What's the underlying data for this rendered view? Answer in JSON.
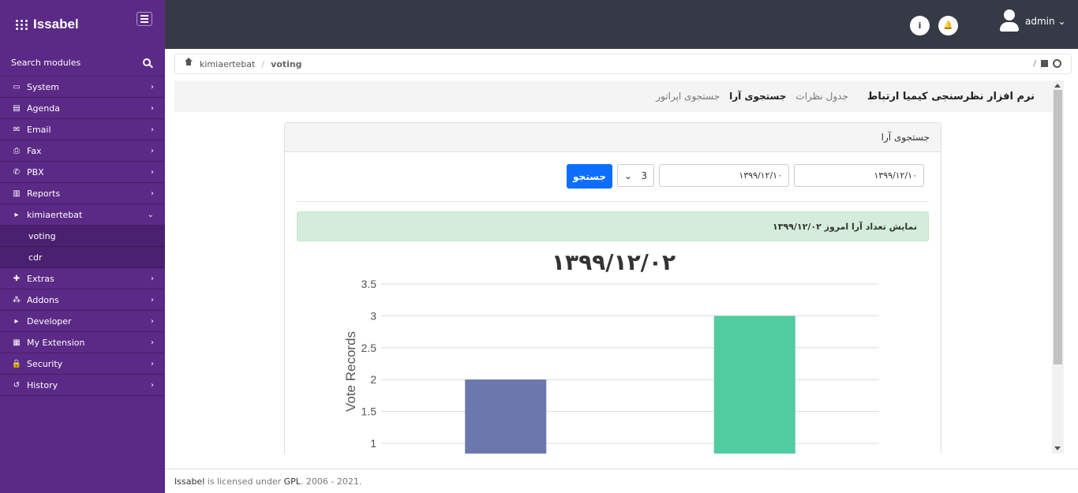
{
  "brand": {
    "name": "Issabel"
  },
  "sidebar": {
    "search_label": "Search modules",
    "items": [
      {
        "label": "System",
        "icon": "laptop-icon",
        "glyph": "▭",
        "chevron": "›"
      },
      {
        "label": "Agenda",
        "icon": "book-icon",
        "glyph": "▤",
        "chevron": "›"
      },
      {
        "label": "Email",
        "icon": "envelope-icon",
        "glyph": "✉",
        "chevron": "›"
      },
      {
        "label": "Fax",
        "icon": "printer-icon",
        "glyph": "⎙",
        "chevron": "›"
      },
      {
        "label": "PBX",
        "icon": "phone-icon",
        "glyph": "✆",
        "chevron": "›"
      },
      {
        "label": "Reports",
        "icon": "bar-chart-icon",
        "glyph": "▥",
        "chevron": "›"
      },
      {
        "label": "kimiaertebat",
        "icon": "caret-right-icon",
        "glyph": "▸",
        "chevron": "⌄"
      },
      {
        "label": "Extras",
        "icon": "plus-icon",
        "glyph": "✚",
        "chevron": "›"
      },
      {
        "label": "Addons",
        "icon": "cubes-icon",
        "glyph": "⁂",
        "chevron": "›"
      },
      {
        "label": "Developer",
        "icon": "caret-right-icon",
        "glyph": "▸",
        "chevron": "›"
      },
      {
        "label": "My Extension",
        "icon": "building-icon",
        "glyph": "▦",
        "chevron": "›"
      },
      {
        "label": "Security",
        "icon": "lock-icon",
        "glyph": "🔒",
        "chevron": "›"
      },
      {
        "label": "History",
        "icon": "history-icon",
        "glyph": "↺",
        "chevron": "›"
      }
    ],
    "subitems": [
      {
        "label": "voting"
      },
      {
        "label": "cdr"
      }
    ]
  },
  "topbar": {
    "info_glyph": "i",
    "bell_glyph": "🔔",
    "user": "admin ⌄"
  },
  "breadcrumb": {
    "module": "kimiaertebat",
    "separator": "/",
    "current": "voting",
    "right_sep": "/"
  },
  "module": {
    "title": "نرم افزار نظرسنجی کیمیا ارتباط",
    "tabs": [
      "جدول نظرات",
      "جستجوی آرا",
      "جستجوی اپراتور"
    ]
  },
  "panel": {
    "title": "جستجوی آرا",
    "date_from": "۱۳۹۹/۱۲/۱۰",
    "date_to": "۱۳۹۹/۱۲/۱۰",
    "select_value": "3",
    "search_button": "جستجو",
    "alert": "نمایش تعداد آرا امروز ۱۳۹۹/۱۲/۰۲"
  },
  "chart_data": {
    "type": "bar",
    "title": "۱۳۹۹/۱۲/۰۲",
    "ylabel": "Vote Records",
    "xlabel": "",
    "ylim": [
      1,
      3.5
    ],
    "yticks": [
      "3.5",
      "3",
      "2.5",
      "2",
      "1.5",
      "1"
    ],
    "categories": [
      "",
      ""
    ],
    "values": [
      2,
      3
    ],
    "colors": [
      "#6c78ad",
      "#50cc9f"
    ],
    "grid": true
  },
  "footer": {
    "brand": "Issabel",
    "text1": " is licensed under ",
    "license": "GPL",
    "text2": ". 2006 - 2021."
  }
}
